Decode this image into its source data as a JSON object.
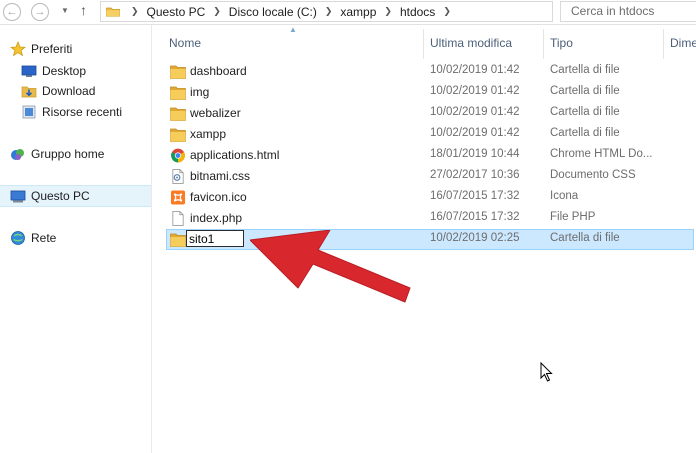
{
  "toolbar": {
    "back_icon": "arrow-left-icon",
    "forward_icon": "arrow-right-icon",
    "up_icon": "arrow-up-icon",
    "breadcrumb": [
      "Questo PC",
      "Disco locale (C:)",
      "xampp",
      "htdocs"
    ],
    "search_placeholder": "Cerca in htdocs"
  },
  "sidebar": {
    "items": [
      {
        "label": "Preferiti",
        "icon": "star-icon"
      },
      {
        "label": "Desktop",
        "icon": "desktop-icon"
      },
      {
        "label": "Download",
        "icon": "download-folder-icon"
      },
      {
        "label": "Risorse recenti",
        "icon": "recent-places-icon"
      },
      {
        "label": "Gruppo home",
        "icon": "homegroup-icon"
      },
      {
        "label": "Questo PC",
        "icon": "computer-icon"
      },
      {
        "label": "Rete",
        "icon": "network-icon"
      }
    ]
  },
  "columns": {
    "name": "Nome",
    "modified": "Ultima modifica",
    "type": "Tipo",
    "size": "Dime"
  },
  "files": [
    {
      "name": "dashboard",
      "modified": "10/02/2019 01:42",
      "type": "Cartella di file",
      "icon": "folder-icon"
    },
    {
      "name": "img",
      "modified": "10/02/2019 01:42",
      "type": "Cartella di file",
      "icon": "folder-icon"
    },
    {
      "name": "webalizer",
      "modified": "10/02/2019 01:42",
      "type": "Cartella di file",
      "icon": "folder-icon"
    },
    {
      "name": "xampp",
      "modified": "10/02/2019 01:42",
      "type": "Cartella di file",
      "icon": "folder-icon"
    },
    {
      "name": "applications.html",
      "modified": "18/01/2019 10:44",
      "type": "Chrome HTML Do...",
      "icon": "chrome-icon"
    },
    {
      "name": "bitnami.css",
      "modified": "27/02/2017 10:36",
      "type": "Documento CSS",
      "icon": "css-file-icon"
    },
    {
      "name": "favicon.ico",
      "modified": "16/07/2015 17:32",
      "type": "Icona",
      "icon": "xampp-icon"
    },
    {
      "name": "index.php",
      "modified": "16/07/2015 17:32",
      "type": "File PHP",
      "icon": "file-icon"
    }
  ],
  "renaming": {
    "value": "sito1",
    "modified": "10/02/2019 02:25",
    "type": "Cartella di file",
    "icon": "folder-icon"
  },
  "colors": {
    "selection_bg": "#cce8ff",
    "selection_border": "#99d1ff",
    "arrow_red": "#d9272e",
    "header_text": "#4c607a"
  }
}
